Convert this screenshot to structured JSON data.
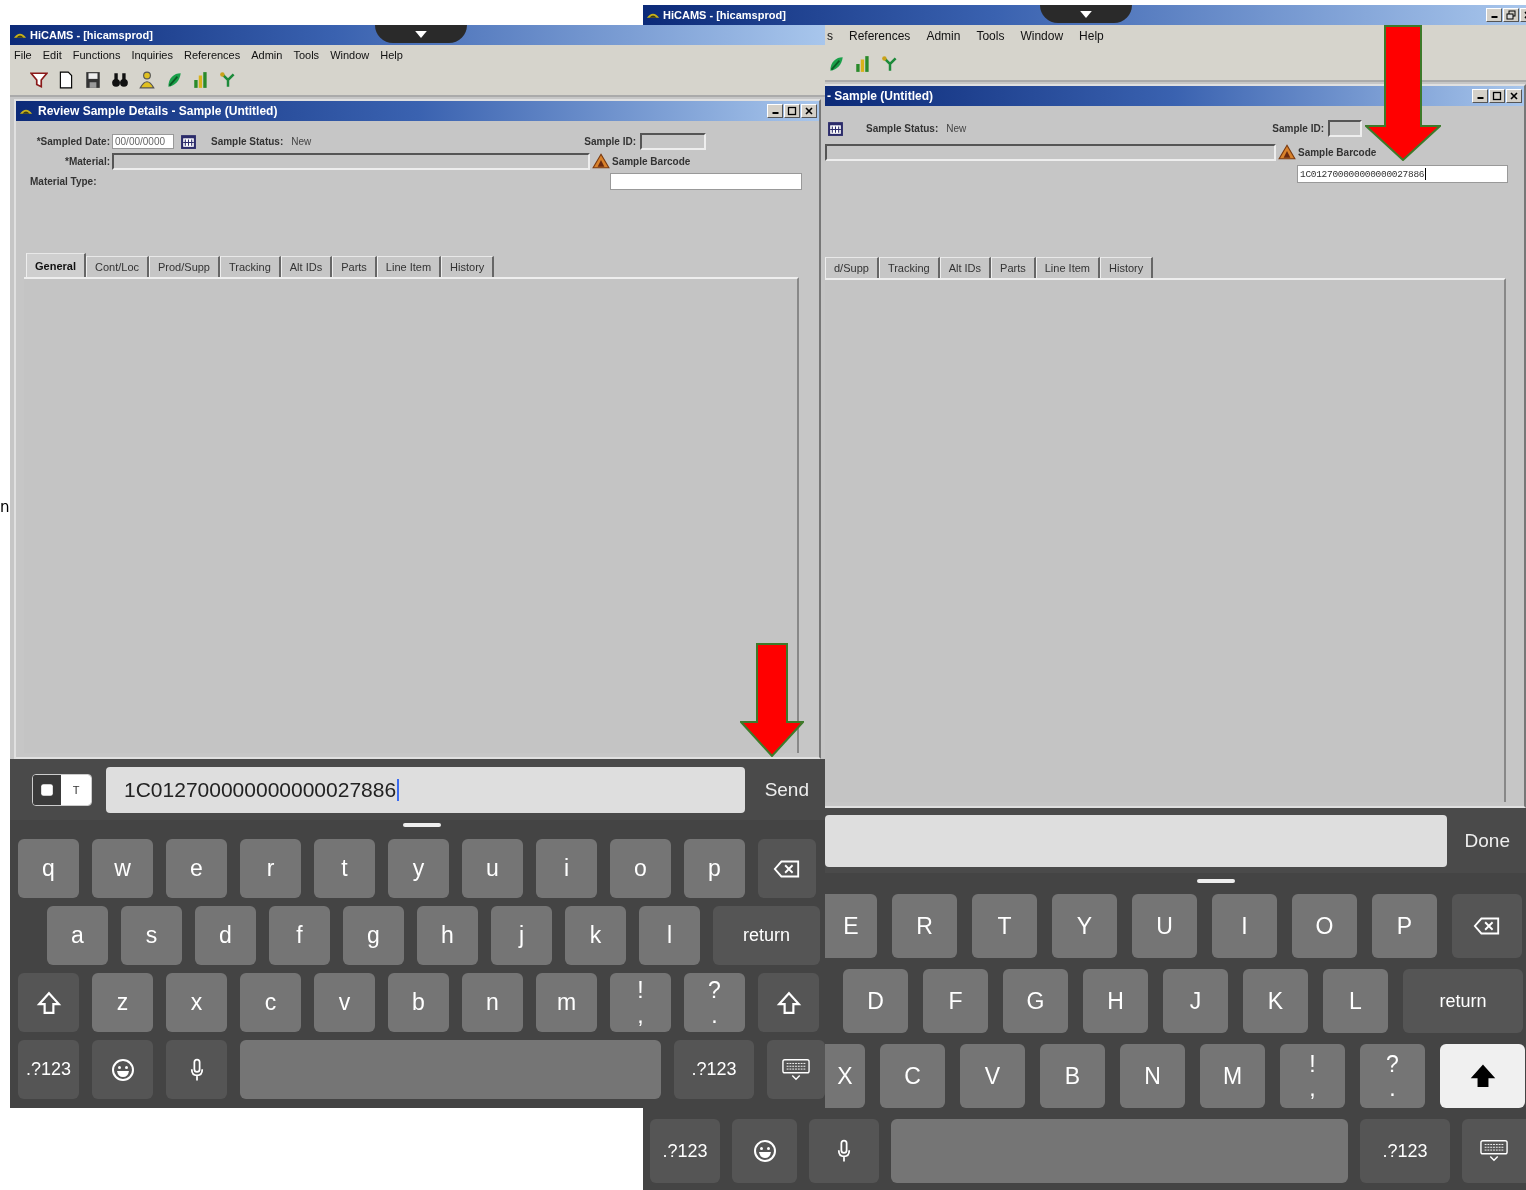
{
  "edge_text": "n",
  "left_screen": {
    "app_title": "HiCAMS - [hicamsprod]",
    "menu": [
      "File",
      "Edit",
      "Functions",
      "Inquiries",
      "References",
      "Admin",
      "Tools",
      "Window",
      "Help"
    ],
    "child_window": {
      "title": "Review Sample Details - Sample (Untitled)",
      "form": {
        "sampled_date_label": "*Sampled Date:",
        "sampled_date": "00/00/0000",
        "status_label": "Sample Status:",
        "status": "New",
        "sample_id_label": "Sample ID:",
        "material_label": "*Material:",
        "barcode_label": "Sample Barcode",
        "material_type_label": "Material Type:"
      },
      "tabs": [
        {
          "label": "General",
          "selected": true
        },
        {
          "label": "Cont/Loc",
          "selected": false
        },
        {
          "label": "Prod/Supp",
          "selected": false
        },
        {
          "label": "Tracking",
          "selected": false
        },
        {
          "label": "Alt IDs",
          "selected": false
        },
        {
          "label": "Parts",
          "selected": false
        },
        {
          "label": "Line Item",
          "selected": false
        },
        {
          "label": "History",
          "selected": false
        }
      ]
    },
    "input_bar": {
      "toggle_label": "T",
      "value": "1C012700000000000027886",
      "focused": true,
      "action": "Send"
    },
    "keyboard": {
      "rows": [
        {
          "keys": [
            {
              "kind": "letter",
              "label": "q"
            },
            {
              "kind": "letter",
              "label": "w"
            },
            {
              "kind": "letter",
              "label": "e"
            },
            {
              "kind": "letter",
              "label": "r"
            },
            {
              "kind": "letter",
              "label": "t"
            },
            {
              "kind": "letter",
              "label": "y"
            },
            {
              "kind": "letter",
              "label": "u"
            },
            {
              "kind": "letter",
              "label": "i"
            },
            {
              "kind": "letter",
              "label": "o"
            },
            {
              "kind": "letter",
              "label": "p"
            },
            {
              "kind": "backspace"
            }
          ]
        },
        {
          "keys": [
            {
              "kind": "letter",
              "label": "a"
            },
            {
              "kind": "letter",
              "label": "s"
            },
            {
              "kind": "letter",
              "label": "d"
            },
            {
              "kind": "letter",
              "label": "f"
            },
            {
              "kind": "letter",
              "label": "g"
            },
            {
              "kind": "letter",
              "label": "h"
            },
            {
              "kind": "letter",
              "label": "j"
            },
            {
              "kind": "letter",
              "label": "k"
            },
            {
              "kind": "letter",
              "label": "l"
            },
            {
              "kind": "return",
              "label": "return"
            }
          ]
        },
        {
          "keys": [
            {
              "kind": "shift",
              "on": false
            },
            {
              "kind": "letter",
              "label": "z"
            },
            {
              "kind": "letter",
              "label": "x"
            },
            {
              "kind": "letter",
              "label": "c"
            },
            {
              "kind": "letter",
              "label": "v"
            },
            {
              "kind": "letter",
              "label": "b"
            },
            {
              "kind": "letter",
              "label": "n"
            },
            {
              "kind": "letter",
              "label": "m"
            },
            {
              "kind": "punct",
              "label": "!",
              "sub": ","
            },
            {
              "kind": "punct",
              "label": "?",
              "sub": "."
            },
            {
              "kind": "shift",
              "on": false
            }
          ]
        },
        {
          "keys": [
            {
              "kind": "numbers",
              "label": ".?123"
            },
            {
              "kind": "emoji"
            },
            {
              "kind": "mic"
            },
            {
              "kind": "space"
            },
            {
              "kind": "numbers",
              "label": ".?123"
            },
            {
              "kind": "hide"
            }
          ]
        }
      ]
    }
  },
  "right_screen": {
    "app_title": "HiCAMS - [hicamsprod]",
    "menu": [
      "s",
      "References",
      "Admin",
      "Tools",
      "Window",
      "Help"
    ],
    "child_window": {
      "title": "- Sample (Untitled)",
      "form": {
        "status_label": "Sample Status:",
        "status": "New",
        "sample_id_label": "Sample ID:",
        "barcode_label": "Sample Barcode",
        "barcode": "1C012700000000000027886",
        "barcode_focused": true
      },
      "tabs": [
        {
          "label": "d/Supp",
          "selected": false
        },
        {
          "label": "Tracking",
          "selected": false
        },
        {
          "label": "Alt IDs",
          "selected": false
        },
        {
          "label": "Parts",
          "selected": false
        },
        {
          "label": "Line Item",
          "selected": false
        },
        {
          "label": "History",
          "selected": false
        }
      ]
    },
    "input_bar": {
      "action": "Done"
    },
    "keyboard": {
      "rows": [
        {
          "keys": [
            {
              "kind": "letter",
              "label": "E"
            },
            {
              "kind": "letter",
              "label": "R"
            },
            {
              "kind": "letter",
              "label": "T"
            },
            {
              "kind": "letter",
              "label": "Y"
            },
            {
              "kind": "letter",
              "label": "U"
            },
            {
              "kind": "letter",
              "label": "I"
            },
            {
              "kind": "letter",
              "label": "O"
            },
            {
              "kind": "letter",
              "label": "P"
            },
            {
              "kind": "backspace"
            }
          ]
        },
        {
          "keys": [
            {
              "kind": "letter",
              "label": "D"
            },
            {
              "kind": "letter",
              "label": "F"
            },
            {
              "kind": "letter",
              "label": "G"
            },
            {
              "kind": "letter",
              "label": "H"
            },
            {
              "kind": "letter",
              "label": "J"
            },
            {
              "kind": "letter",
              "label": "K"
            },
            {
              "kind": "letter",
              "label": "L"
            },
            {
              "kind": "return",
              "label": "return"
            }
          ]
        },
        {
          "keys": [
            {
              "kind": "letter",
              "label": "X"
            },
            {
              "kind": "letter",
              "label": "C"
            },
            {
              "kind": "letter",
              "label": "V"
            },
            {
              "kind": "letter",
              "label": "B"
            },
            {
              "kind": "letter",
              "label": "N"
            },
            {
              "kind": "letter",
              "label": "M"
            },
            {
              "kind": "punct",
              "label": "!",
              "sub": ","
            },
            {
              "kind": "punct",
              "label": "?",
              "sub": "."
            },
            {
              "kind": "shift",
              "on": true
            }
          ]
        },
        {
          "keys": [
            {
              "kind": "numbers",
              "label": ".?123"
            },
            {
              "kind": "emoji"
            },
            {
              "kind": "mic"
            },
            {
              "kind": "space"
            },
            {
              "kind": "numbers",
              "label": ".?123"
            },
            {
              "kind": "hide"
            }
          ]
        }
      ]
    }
  }
}
